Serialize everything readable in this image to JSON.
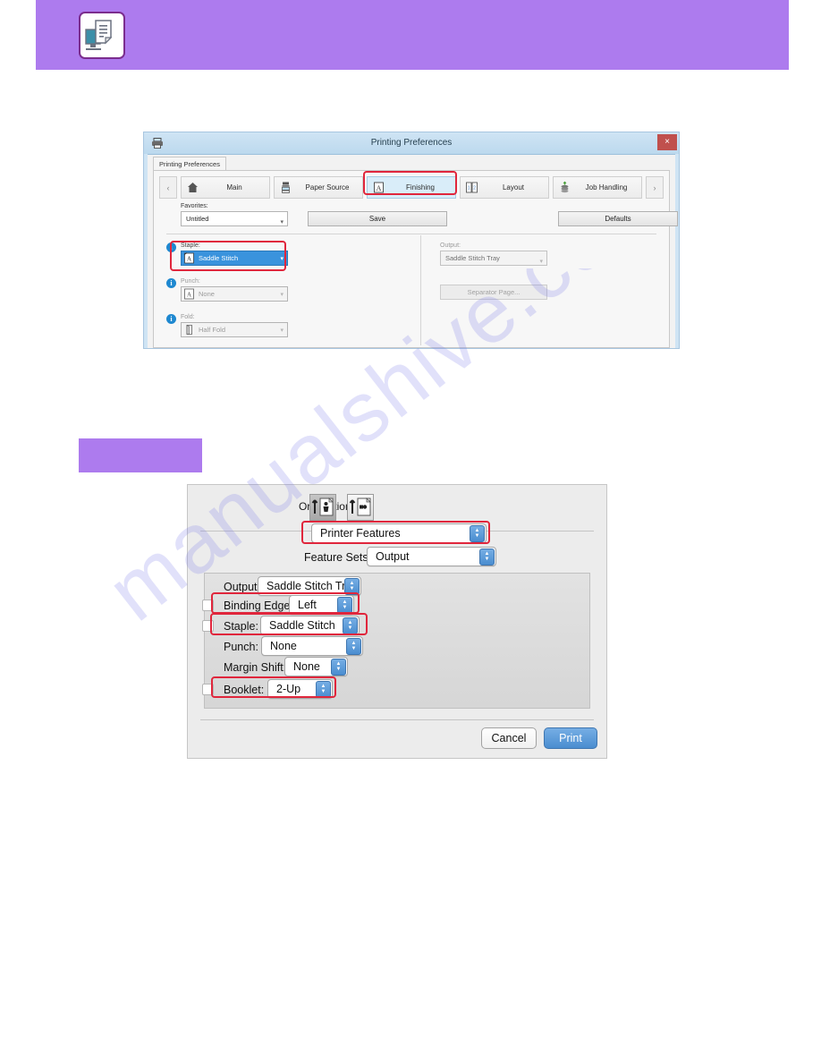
{
  "page": {
    "watermark": "manualshive.com",
    "banner_color": "#ad7bee",
    "highlight_color": "#e0263c",
    "accent_blue": "#3a93dd"
  },
  "banner": {
    "icon": "printer-document-icon"
  },
  "purple_label": {
    "text": ""
  },
  "windows_dialog": {
    "title": "Printing Preferences",
    "close_label": "×",
    "subtab_label": "Printing Preferences",
    "tab_prev": "‹",
    "tab_next": "›",
    "tabs": [
      {
        "label": "Main",
        "icon": "home-icon",
        "active": false
      },
      {
        "label": "Paper Source",
        "icon": "paper-tray-icon",
        "active": false
      },
      {
        "label": "Finishing",
        "icon": "letter-a-page-icon",
        "active": true
      },
      {
        "label": "Layout",
        "icon": "two-page-layout-icon",
        "active": false
      },
      {
        "label": "Job Handling",
        "icon": "stack-icon",
        "active": false
      }
    ],
    "favorites": {
      "caption": "Favorites:",
      "value": "Untitled",
      "save_label": "Save",
      "defaults_label": "Defaults"
    },
    "left_options": [
      {
        "caption": "Staple:",
        "value": "Saddle Stitch",
        "icon": "staple-a-icon",
        "state": "selected",
        "info": "i"
      },
      {
        "caption": "Punch:",
        "value": "None",
        "icon": "punch-a-icon",
        "state": "disabled",
        "info": "i"
      },
      {
        "caption": "Fold:",
        "value": "Half Fold",
        "icon": "fold-icon",
        "state": "disabled",
        "info": "i"
      }
    ],
    "right_options": {
      "output_caption": "Output:",
      "output_value": "Saddle Stitch Tray",
      "separator_label": "Separator Page..."
    }
  },
  "mac_dialog": {
    "orientation_label": "Orientation:",
    "orientation_buttons": [
      {
        "name": "portrait-orientation",
        "selected": true
      },
      {
        "name": "landscape-orientation",
        "selected": false
      }
    ],
    "panel_popup": "Printer Features",
    "feature_sets_label": "Feature Sets:",
    "feature_sets_value": "Output",
    "rows": [
      {
        "label": "Output:",
        "value": "Saddle Stitch Tray",
        "highlighted": false
      },
      {
        "label": "Binding Edge:",
        "value": "Left",
        "highlighted": true
      },
      {
        "label": "Staple:",
        "value": "Saddle Stitch",
        "highlighted": true
      },
      {
        "label": "Punch:",
        "value": "None",
        "highlighted": false
      },
      {
        "label": "Margin Shift:",
        "value": "None",
        "highlighted": false
      },
      {
        "label": "Booklet:",
        "value": "2-Up",
        "highlighted": true
      }
    ],
    "cancel_label": "Cancel",
    "print_label": "Print"
  }
}
